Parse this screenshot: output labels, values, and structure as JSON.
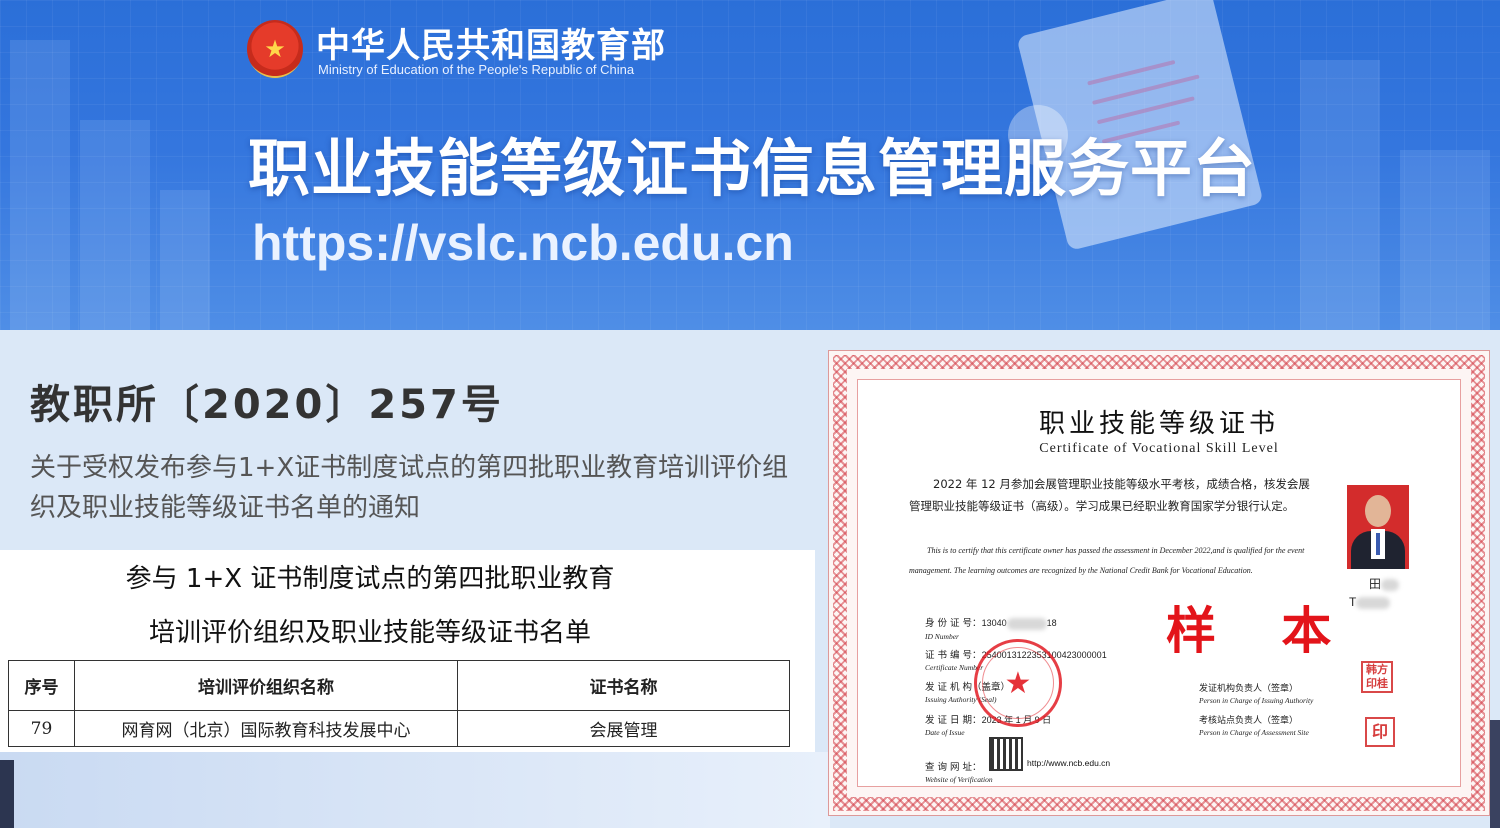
{
  "banner": {
    "ministry_cn": "中华人民共和国教育部",
    "ministry_en": "Ministry of Education of the People's Republic of China",
    "platform_title": "职业技能等级证书信息管理服务平台",
    "url": "https://vslc.ncb.edu.cn",
    "emblem": "national-emblem-icon"
  },
  "notice": {
    "doc_number": "教职所〔2020〕257号",
    "title": "关于受权发布参与1+X证书制度试点的第四批职业教育培训评价组织及职业技能等级证书名单的通知"
  },
  "document": {
    "heading_line1": "参与 1+X 证书制度试点的第四批职业教育",
    "heading_line2": "培训评价组织及职业技能等级证书名单",
    "columns": [
      "序号",
      "培训评价组织名称",
      "证书名称"
    ],
    "rows": [
      [
        "79",
        "网育网（北京）国际教育科技发展中心",
        "会展管理"
      ]
    ]
  },
  "certificate": {
    "title": "职业技能等级证书",
    "subtitle": "Certificate of Vocational Skill Level",
    "body_cn": "2022 年 12 月参加会展管理职业技能等级水平考核，成绩合格，核发会展管理职业技能等级证书（高级）。学习成果已经职业教育国家学分银行认定。",
    "body_en": "This is to certify that this certificate owner has passed the assessment in December 2022,and is qualified for the event management. The learning outcomes are recognized by the National Credit Bank for Vocational Education.",
    "sample_mark": "样 本",
    "holder_name": "田",
    "holder_pinyin": "T",
    "id_label": "身 份 证 号：",
    "id_value": "13040",
    "id_value_tail": "18",
    "id_label_en": "ID Number",
    "cert_no_label": "证 书 编 号：",
    "cert_no_value": "2540013122353100423000001",
    "cert_no_label_en": "Certificate Number",
    "authority_label": "发 证 机 构（盖章）",
    "authority_label_en": "Issuing Authority (Seal)",
    "date_label": "发 证 日 期：",
    "date_value": "2023 年 1 月 9 日",
    "date_label_en": "Date of Issue",
    "website_label": "查 询 网 址：",
    "website_value": "http://www.ncb.edu.cn",
    "website_label_en": "Website of Verification",
    "signer1_cn": "发证机构负责人（签章）",
    "signer1_en": "Person in Charge of Issuing Authority",
    "signer2_cn": "考核站点负责人（签章）",
    "signer2_en": "Person in Charge of Assessment Site",
    "stamp1_text": "韩方印桂",
    "stamp2_text": "印"
  },
  "colors": {
    "banner_blue": "#3476de",
    "seal_red": "#e21c24",
    "sample_red": "#e3141a"
  }
}
